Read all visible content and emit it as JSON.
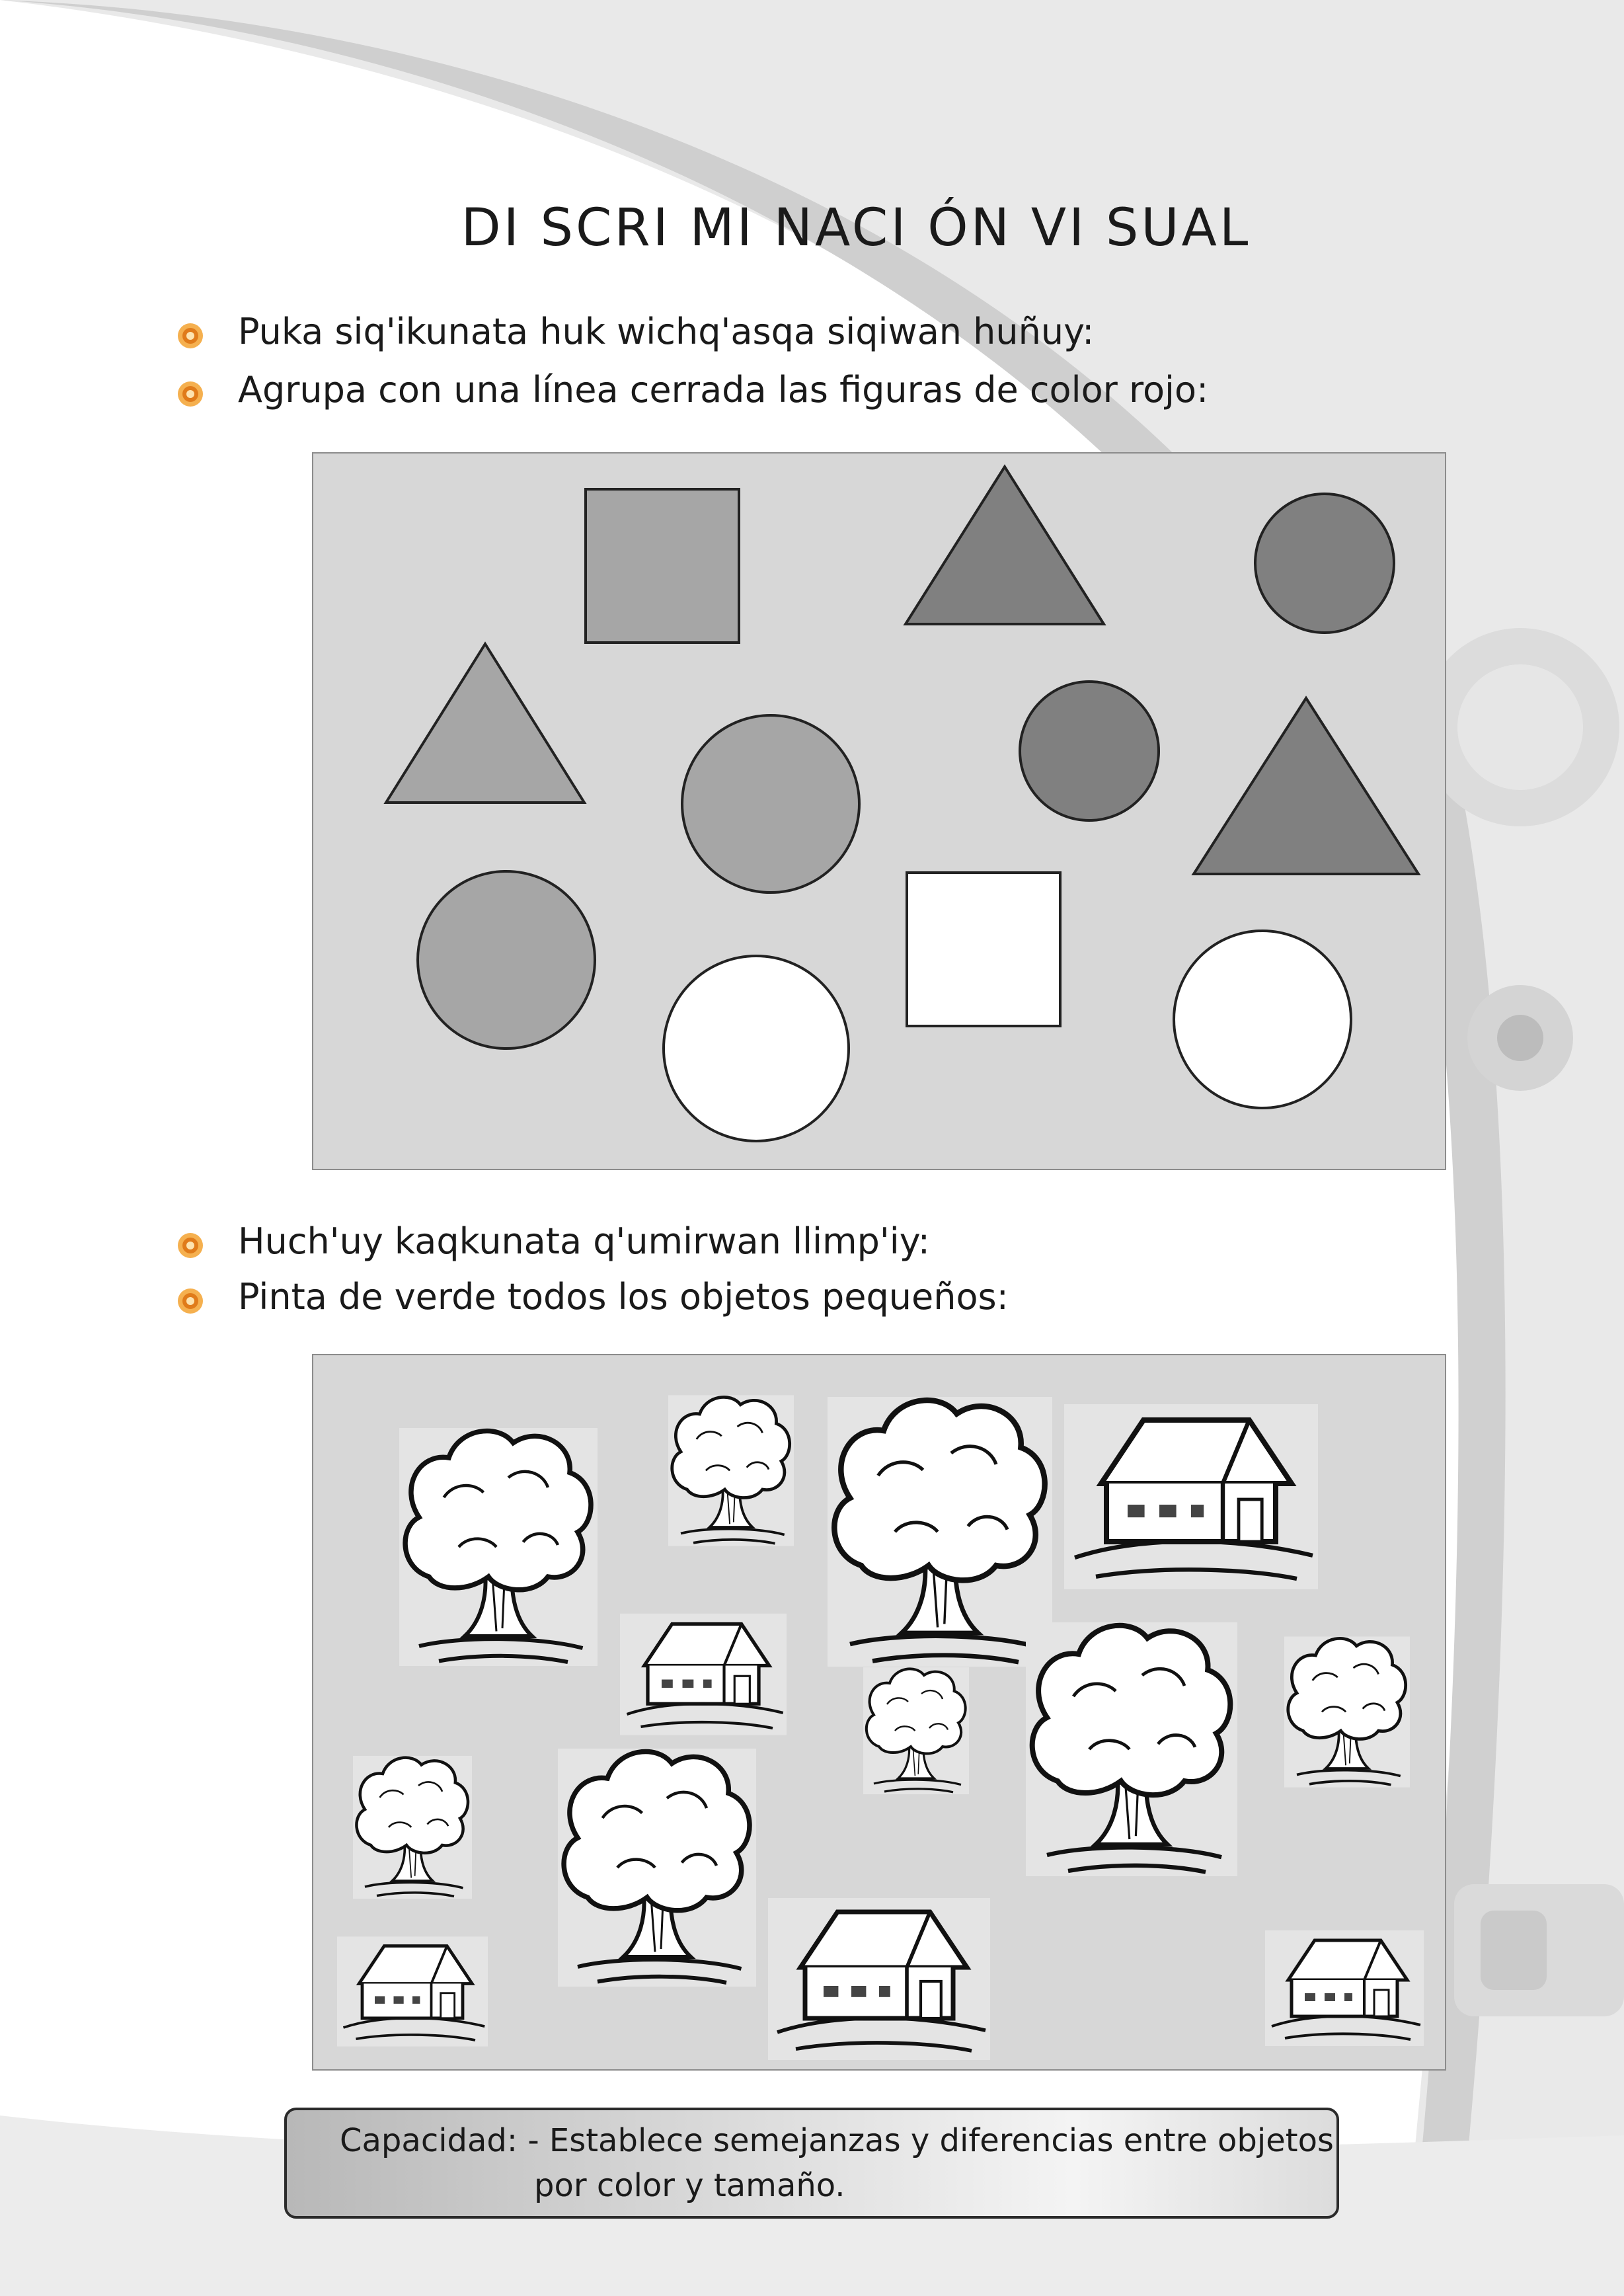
{
  "title": "DI SCRI MI NACI ÓN VI SUAL",
  "section1": {
    "instruction_quechua": "Puka siq'ikunata huk wichq'asqa  siqiwan huñuy:",
    "instruction_spanish": "Agrupa con una línea cerrada las figuras de color rojo:",
    "shapes": [
      {
        "kind": "square",
        "fill": "gray"
      },
      {
        "kind": "triangle",
        "fill": "dark-gray"
      },
      {
        "kind": "circle",
        "fill": "dark-gray"
      },
      {
        "kind": "triangle",
        "fill": "gray"
      },
      {
        "kind": "circle",
        "fill": "gray"
      },
      {
        "kind": "circle",
        "fill": "dark-gray"
      },
      {
        "kind": "triangle",
        "fill": "dark-gray"
      },
      {
        "kind": "circle",
        "fill": "gray"
      },
      {
        "kind": "square",
        "fill": "white"
      },
      {
        "kind": "circle",
        "fill": "white"
      },
      {
        "kind": "circle",
        "fill": "white"
      }
    ]
  },
  "section2": {
    "instruction_quechua": "Huch'uy kaqkunata q'umirwan llimp'iy:",
    "instruction_spanish": "Pinta de verde todos los objetos pequeños:",
    "objects": [
      {
        "kind": "tree",
        "size": "medium"
      },
      {
        "kind": "tree",
        "size": "small"
      },
      {
        "kind": "tree",
        "size": "large"
      },
      {
        "kind": "house",
        "size": "large"
      },
      {
        "kind": "house",
        "size": "small"
      },
      {
        "kind": "tree",
        "size": "small"
      },
      {
        "kind": "tree",
        "size": "large"
      },
      {
        "kind": "tree",
        "size": "small"
      },
      {
        "kind": "tree",
        "size": "small"
      },
      {
        "kind": "tree",
        "size": "medium"
      },
      {
        "kind": "house",
        "size": "small"
      },
      {
        "kind": "house",
        "size": "large"
      },
      {
        "kind": "house",
        "size": "small"
      }
    ]
  },
  "capacity": {
    "line1": "Capacidad: - Establece semejanzas y diferencias entre objetos",
    "line2": "por color y tamaño."
  },
  "colors": {
    "panel": "#d7d7d7",
    "shape_gray": "#a6a6a6",
    "shape_dark_gray": "#808080",
    "shape_white": "#ffffff",
    "bullet": "#e8912f"
  }
}
